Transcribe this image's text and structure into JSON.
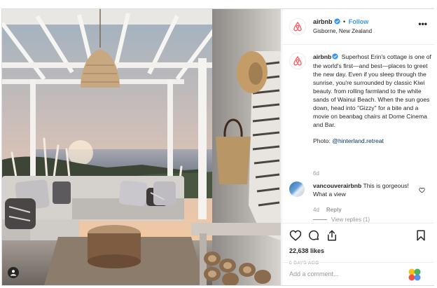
{
  "post": {
    "account": "airbnb",
    "follow_label": "Follow",
    "dot": "•",
    "location": "Gisborne, New Zealand",
    "more_label": "•••"
  },
  "caption": {
    "account": "airbnb",
    "text": "Superhost Erin's cottage is one of the world's first—and best—places to greet the new day. Even if you sleep through the sunrise, you're surrounded by classic Kiwi beauty. from rolling farmland to the white sands of Wainui Beach. When the sun goes down, head into \"Gizzy\" for a bite and a movie on beanbag chairs at Dome Cinema and Bar.",
    "photo_prefix": "Photo: ",
    "photo_mention": "@hinterland.retreat",
    "age": "6d"
  },
  "comment": {
    "account": "vancouverairbnb",
    "text": "This is gorgeous! What a view",
    "age": "4d",
    "reply_label": "Reply",
    "view_replies": "View replies (1)"
  },
  "actions": {
    "likes": "22,638 likes",
    "posted": "6 DAYS AGO",
    "add_comment_placeholder": "Add a comment..."
  },
  "colors": {
    "brand": "#ff5a5f",
    "link": "#3897f0",
    "mention": "#003569",
    "verified": "#3897f0"
  },
  "icons": [
    "airbnb-logo-icon",
    "verified-badge-icon",
    "more-options-icon",
    "heart-icon",
    "comment-icon",
    "share-icon",
    "bookmark-icon",
    "small-heart-icon",
    "tagged-user-icon",
    "flower-logo-icon"
  ]
}
